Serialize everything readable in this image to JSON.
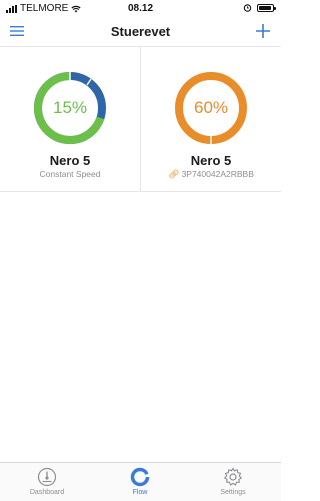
{
  "status_bar": {
    "carrier": "TELMORE",
    "time": "08.12"
  },
  "header": {
    "title": "Stuerevet"
  },
  "devices": [
    {
      "percent_label": "15%",
      "percent": 15,
      "name": "Nero 5",
      "subtitle": "Constant Speed",
      "color": "#6cc04a",
      "secondary_color": "#2f66a8"
    },
    {
      "percent_label": "60%",
      "percent": 60,
      "name": "Nero 5",
      "subtitle": "3P740042A2RBBB",
      "color": "#e88d2a",
      "subtitle_icon": "link-icon"
    }
  ],
  "tabs": [
    {
      "label": "Dashboard",
      "icon": "gauge-icon",
      "active": false
    },
    {
      "label": "Flow",
      "icon": "flow-ring-icon",
      "active": true
    },
    {
      "label": "Settings",
      "icon": "gear-icon",
      "active": false
    }
  ],
  "colors": {
    "accent": "#3a7bd5",
    "green": "#6cc04a",
    "blue": "#2f66a8",
    "orange": "#e88d2a"
  }
}
